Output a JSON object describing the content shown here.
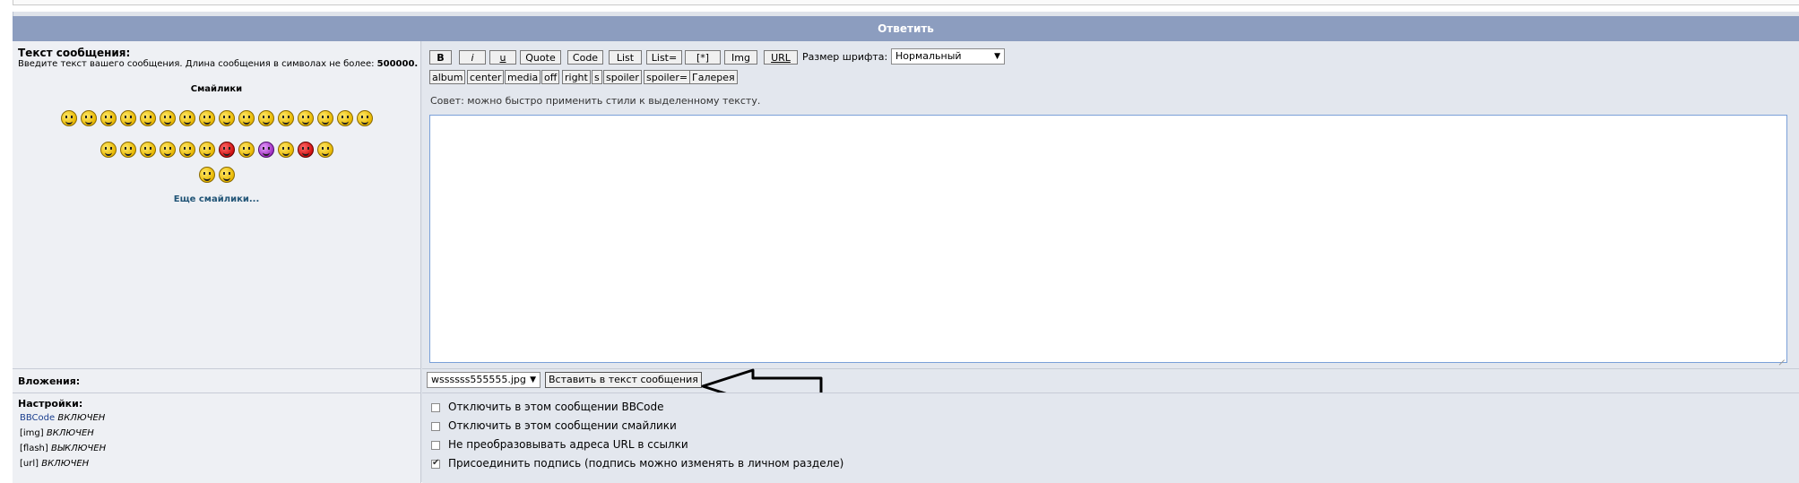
{
  "header": {
    "title": "Ответить"
  },
  "message": {
    "label": "Текст сообщения:",
    "hint_prefix": "Введите текст вашего сообщения. Длина сообщения в символах не более:",
    "hint_limit": "500000.",
    "smilies_title": "Смайлики",
    "more_smilies": "Еще смайлики..."
  },
  "toolbar": {
    "row1": [
      "B",
      "i",
      "u",
      "Quote",
      "Code",
      "List",
      "List=",
      "[*]",
      "Img",
      "URL"
    ],
    "font_size_label": "Размер шрифта:",
    "font_size_value": "Нормальный",
    "row2": [
      "album",
      "center",
      "media",
      "off",
      "right",
      "s",
      "spoiler",
      "spoiler=",
      "Галерея"
    ],
    "tip": "Совет: можно быстро применить стили к выделенному тексту."
  },
  "attachments": {
    "label": "Вложения:",
    "file_value": "wssssss555555.jpg",
    "insert_button": "Вставить в текст сообщения"
  },
  "settings": {
    "label": "Настройки:",
    "items": [
      {
        "name": "BBCode",
        "state": "ВКЛЮЧЕН"
      },
      {
        "name": "[img]",
        "state": "ВКЛЮЧЕН"
      },
      {
        "name": "[flash]",
        "state": "ВЫКЛЮЧЕН"
      },
      {
        "name": "[url]",
        "state": "ВКЛЮЧЕН"
      }
    ],
    "options": [
      {
        "label": "Отключить в этом сообщении BBCode",
        "checked": false
      },
      {
        "label": "Отключить в этом сообщении смайлики",
        "checked": false
      },
      {
        "label": "Не преобразовывать адреса URL в ссылки",
        "checked": false
      },
      {
        "label": "Присоединить подпись (подпись можно изменять в личном разделе)",
        "checked": true
      }
    ]
  },
  "colors": {
    "header_bg": "#8c9dbf",
    "accent": "#7aa0d8"
  }
}
